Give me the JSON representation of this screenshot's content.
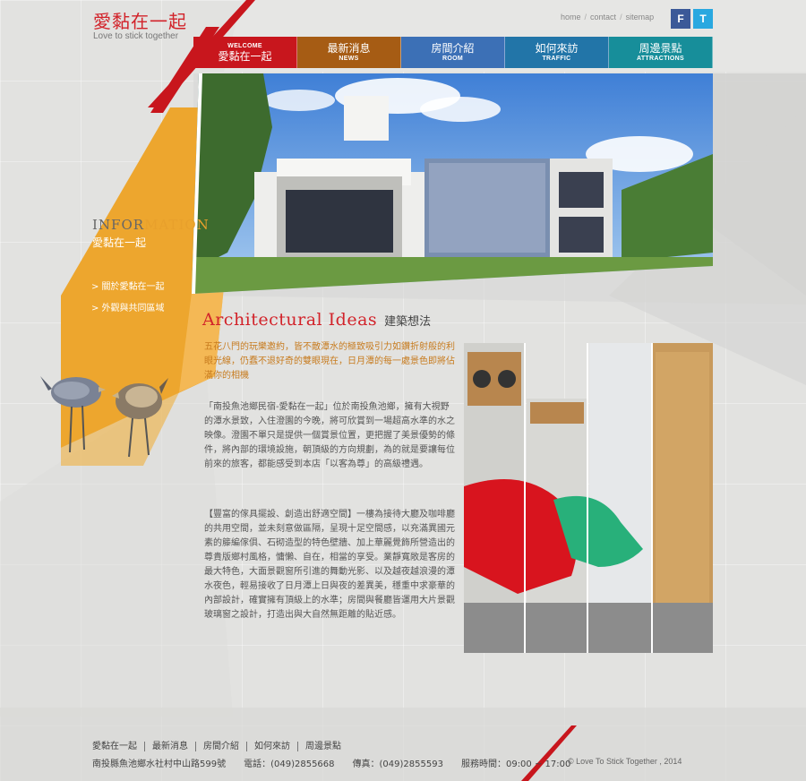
{
  "logo": {
    "title": "愛黏在一起",
    "subtitle": "Love to stick together"
  },
  "toplinks": {
    "home": "home",
    "contact": "contact",
    "sitemap": "sitemap",
    "sep": "/"
  },
  "social": {
    "facebook": "F",
    "twitter": "T"
  },
  "nav": [
    {
      "en": "WELCOME",
      "zh": "愛黏在一起",
      "color": "#c8161d"
    },
    {
      "en": "NEWS",
      "zh": "最新消息",
      "color": "#a65c14"
    },
    {
      "en": "ROOM",
      "zh": "房間介紹",
      "color": "#3c70b6"
    },
    {
      "en": "TRAFFIC",
      "zh": "如何來訪",
      "color": "#2275a8"
    },
    {
      "en": "ATTRACTIONS",
      "zh": "周邊景點",
      "color": "#178e9a"
    }
  ],
  "info": {
    "title_a": "INFOR",
    "title_b": "MATION",
    "subtitle": "愛黏在一起"
  },
  "side_menu": [
    "> 關於愛黏在一起",
    "> 外觀與共同區域"
  ],
  "section": {
    "title_en": "Architectural Ideas",
    "title_zh": "建築想法"
  },
  "lead": "五花八門的玩樂邀約，皆不敵潭水的極致吸引力如鑽折射般的利眼光線，仍蠢不退好奇的雙眼現在，日月潭的每一處景色即將佔滿你的相機",
  "body1": "「南投魚池鄉民宿-愛黏在一起」位於南投魚池鄉，擁有大視野的潭水景致，入住澄園的今晚，將可欣賞到一場超高水準的水之映像。澄園不單只是提供一個賞景位置，更把握了美景優勢的條件，將內部的環境設施，朝頂級的方向規劃，為的就是要讓每位前來的旅客，都能感受到本店「以客為尊」的高級禮遇。",
  "body2": "【豐富的傢具擺設、創造出舒適空間】一樓為接待大廳及咖啡廳的共用空間，並未刻意做區隔，呈現十足空間感，以充滿異國元素的籐編傢俱、石砌造型的特色壁牆、加上華麗覺飾所營造出的尊貴版鄉村風格，慵懶、自在，相當的享受。業靜寬敞是客房的最大特色，大面景觀窗所引進的舞動光影、以及越夜越浪漫的潭水夜色，輕易接收了日月潭上日與夜的差異美，穩重中求豪華的內部設計，確實擁有頂級上的水準；房間與餐廳皆運用大片景觀玻璃窗之設計，打造出與大自然無距離的貼近感。",
  "footer": {
    "links": [
      "愛黏在一起",
      "最新消息",
      "房間介紹",
      "如何來訪",
      "周邊景點"
    ],
    "address": "南投縣魚池鄉水社村中山路599號",
    "phone": "電話：(049)2855668",
    "fax": "傳真：(049)2855593",
    "hours": "服務時間：09:00 ~ 17:00",
    "copyright": "© Love To Stick Together , 2014"
  }
}
